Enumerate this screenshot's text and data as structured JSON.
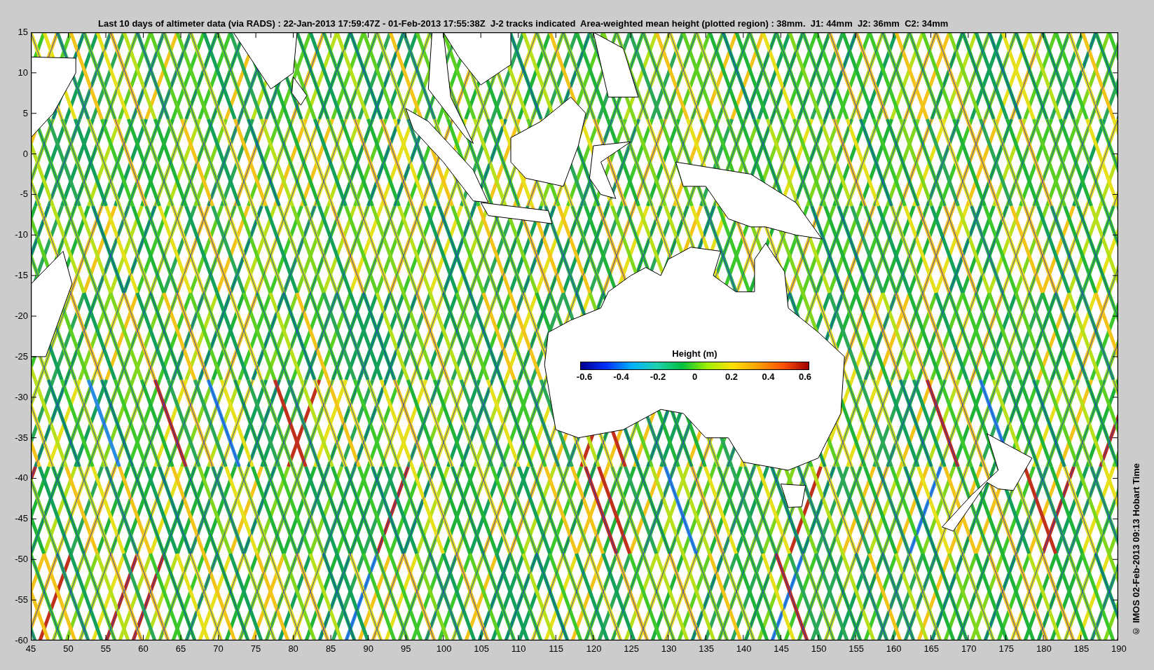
{
  "title": "Last 10 days of altimeter data (via RADS) : 22-Jan-2013 17:59:47Z - 01-Feb-2013 17:55:38Z  J-2 tracks indicated  Area-weighted mean height (plotted region) : 38mm.  J1: 44mm  J2: 36mm  C2: 34mm",
  "y_ticks": [
    "15",
    "10",
    "5",
    "0",
    "-5",
    "-10",
    "-15",
    "-20",
    "-25",
    "-30",
    "-35",
    "-40",
    "-45",
    "-50",
    "-55",
    "-60"
  ],
  "x_ticks": [
    "45",
    "50",
    "55",
    "60",
    "65",
    "70",
    "75",
    "80",
    "85",
    "90",
    "95",
    "100",
    "105",
    "110",
    "115",
    "120",
    "125",
    "130",
    "135",
    "140",
    "145",
    "150",
    "155",
    "160",
    "165",
    "170",
    "175",
    "180",
    "185",
    "190"
  ],
  "colorbar": {
    "label": "Height (m)",
    "ticks": [
      "-0.6",
      "-0.4",
      "-0.2",
      "0",
      "0.2",
      "0.4",
      "0.6"
    ]
  },
  "credit": "© IMOS 02-Feb-2013 09:13 Hobart Time"
}
